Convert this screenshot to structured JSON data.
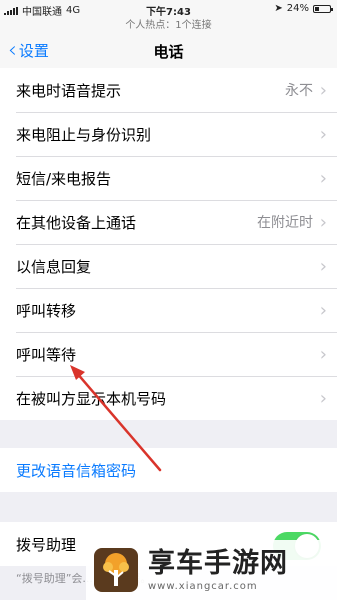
{
  "status": {
    "carrier": "中国联通",
    "network": "4G",
    "time": "下午7:43",
    "battery": "24%",
    "hotspot": "个人热点：1个连接"
  },
  "nav": {
    "back_label": "设置",
    "title": "电话"
  },
  "rows": [
    {
      "label": "来电时语音提示",
      "value": "永不"
    },
    {
      "label": "来电阻止与身份识别",
      "value": ""
    },
    {
      "label": "短信/来电报告",
      "value": ""
    },
    {
      "label": "在其他设备上通话",
      "value": "在附近时"
    },
    {
      "label": "以信息回复",
      "value": ""
    },
    {
      "label": "呼叫转移",
      "value": ""
    },
    {
      "label": "呼叫等待",
      "value": ""
    },
    {
      "label": "在被叫方显示本机号码",
      "value": ""
    }
  ],
  "voicemail": {
    "label": "更改语音信箱密码"
  },
  "dial_assist": {
    "label": "拨号助理",
    "enabled": true
  },
  "footer_note": "“拨号助理”会... 电话前缀。",
  "watermark": {
    "title": "享车手游网",
    "url": "www.xiangcar.com"
  },
  "colors": {
    "accent": "#0a7bff",
    "toggle_on": "#4cd964",
    "arrow": "#d9342b"
  }
}
